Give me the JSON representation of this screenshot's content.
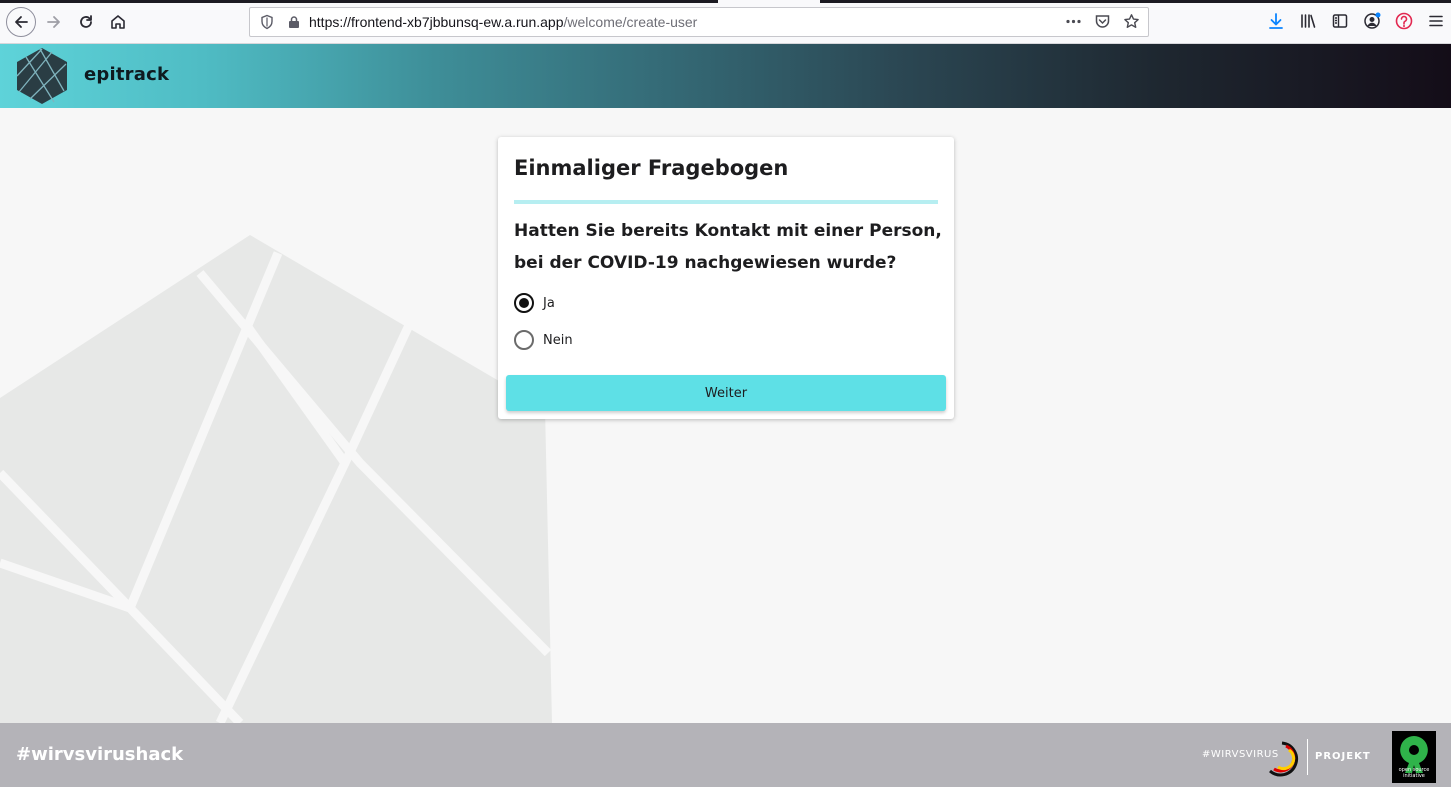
{
  "browser": {
    "url_host": "https://frontend-xb7jbbunsq-ew.a.run.app",
    "url_path": "/welcome/create-user"
  },
  "header": {
    "app_name": "epitrack"
  },
  "form": {
    "title": "Einmaliger Fragebogen",
    "question": "Hatten Sie bereits Kontakt mit einer Person, bei der COVID-19 nachgewiesen wurde?",
    "options": [
      {
        "label": "Ja",
        "selected": true
      },
      {
        "label": "Nein",
        "selected": false
      }
    ],
    "submit_label": "Weiter"
  },
  "footer": {
    "hashtag": "#wirvsvirushack",
    "wvv_logo_text": "#WIRVSVIRUS",
    "projekt_label": "PROJEKT",
    "osi_text": "open source initiative"
  },
  "colors": {
    "accent": "#5ee0e6",
    "divider": "#b6eef1",
    "footer": "#b4b3b8"
  }
}
